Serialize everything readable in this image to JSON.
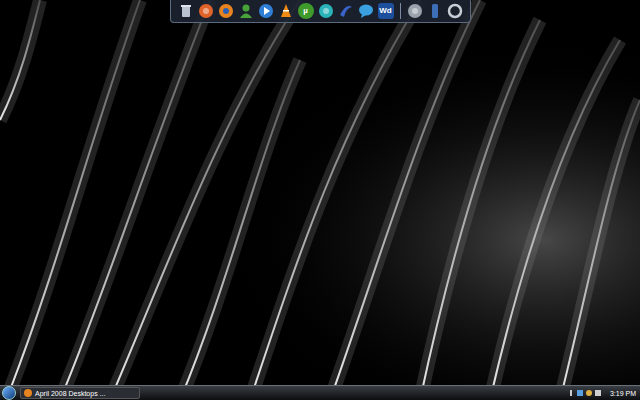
{
  "dock": {
    "items": [
      {
        "kind": "recycle"
      },
      {
        "kind": "orange"
      },
      {
        "kind": "firefox"
      },
      {
        "kind": "messenger"
      },
      {
        "kind": "player"
      },
      {
        "kind": "vlc"
      },
      {
        "kind": "torrent",
        "label": "µ"
      },
      {
        "kind": "teal"
      },
      {
        "kind": "swirl"
      },
      {
        "kind": "bubble"
      },
      {
        "kind": "word",
        "label": "Wd"
      },
      {
        "kind": "separator"
      },
      {
        "kind": "disc"
      },
      {
        "kind": "phone"
      },
      {
        "kind": "ring"
      }
    ]
  },
  "taskbar": {
    "buttons": [
      {
        "label": "April 2008 Desktops ...",
        "selected": false
      }
    ],
    "clock": "3:19 PM"
  }
}
